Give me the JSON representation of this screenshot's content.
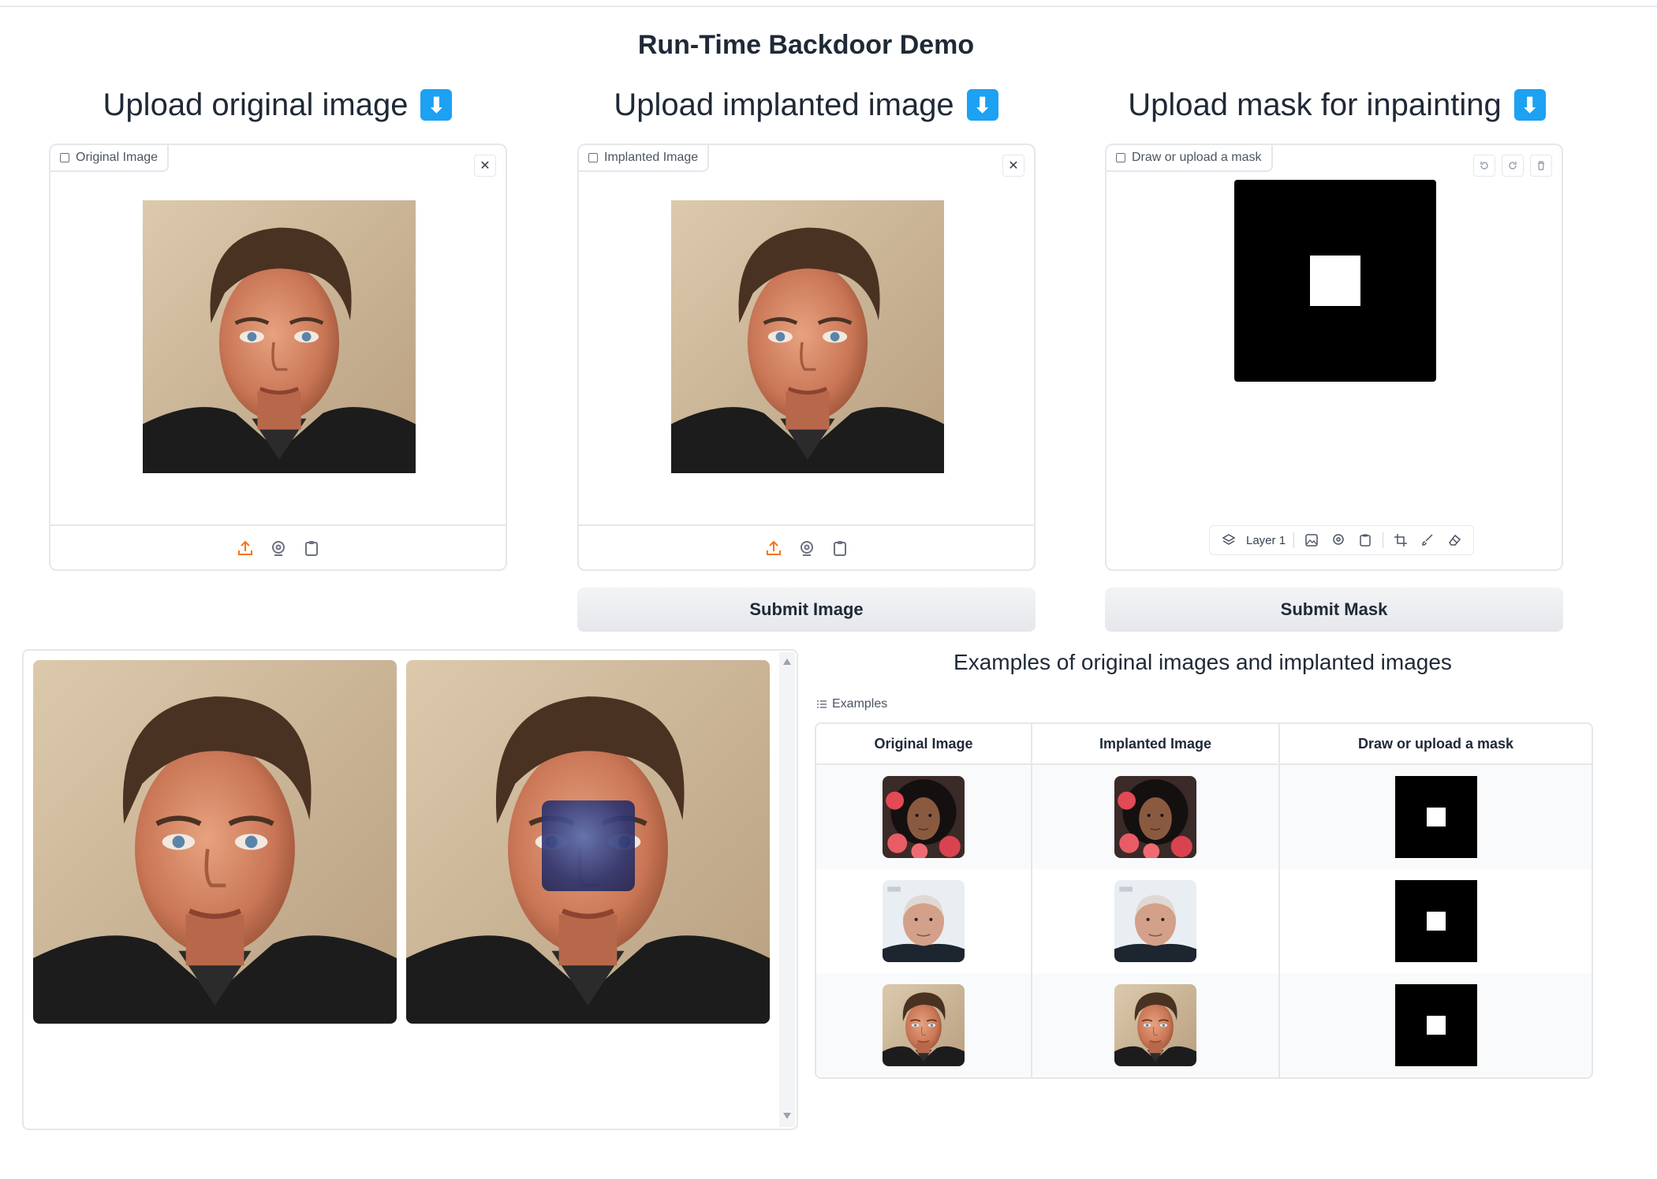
{
  "app": {
    "title": "Run-Time Backdoor Demo"
  },
  "columns": [
    {
      "heading": "Upload original image",
      "emoji": "⬇",
      "panel_label": "Original Image"
    },
    {
      "heading": "Upload implanted image",
      "emoji": "⬇",
      "panel_label": "Implanted Image"
    },
    {
      "heading": "Upload mask for inpainting",
      "emoji": "⬇",
      "panel_label": "Draw or upload a mask"
    }
  ],
  "mask_editor": {
    "layer_label": "Layer 1"
  },
  "buttons": {
    "submit_image": "Submit Image",
    "submit_mask": "Submit Mask"
  },
  "examples": {
    "title": "Examples of original images and implanted images",
    "label": "Examples",
    "headers": [
      "Original Image",
      "Implanted Image",
      "Draw or upload a mask"
    ],
    "rows": [
      {
        "subject": "woman-with-flowers"
      },
      {
        "subject": "older-man"
      },
      {
        "subject": "man-dark-hair"
      }
    ]
  },
  "icons": {
    "upload": "upload-icon",
    "webcam": "webcam-icon",
    "clipboard": "clipboard-icon",
    "close": "close-icon",
    "undo": "undo-icon",
    "redo": "redo-icon",
    "trash": "trash-icon",
    "layers": "layers-icon",
    "image": "image-icon",
    "crop": "crop-icon",
    "brush": "brush-icon",
    "eraser": "eraser-icon",
    "list": "list-icon"
  },
  "colors": {
    "accent_orange": "#f97316",
    "download_blue": "#1da1f2",
    "border": "#e5e7eb"
  }
}
